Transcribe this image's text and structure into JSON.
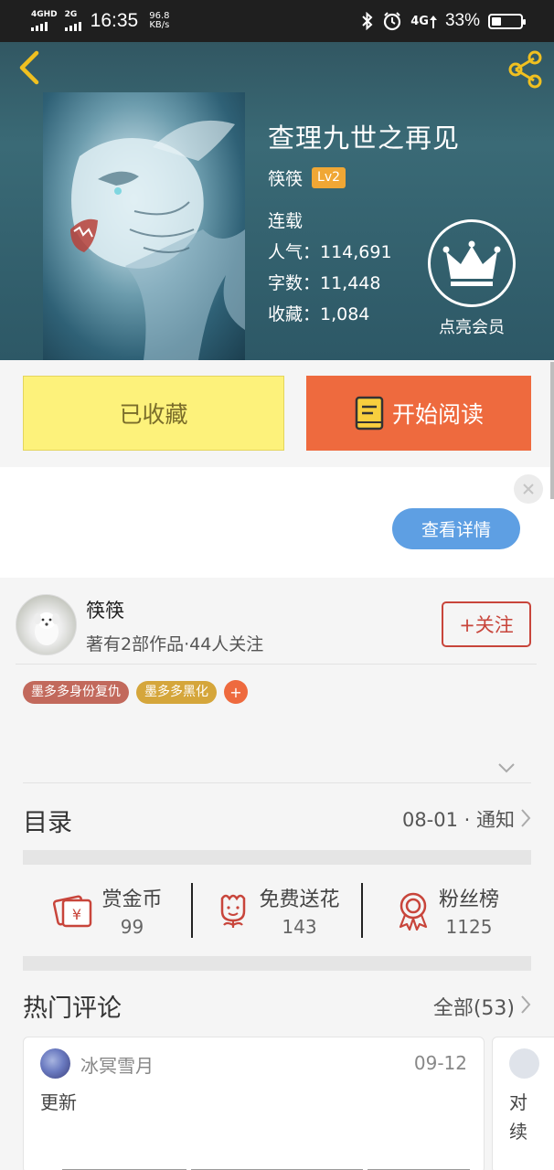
{
  "status_bar": {
    "sim1_label": "4GHD",
    "sim2_label": "2G",
    "time": "16:35",
    "speed_value": "96.8",
    "speed_unit": "KB/s",
    "network_label": "4G",
    "battery_percent": "33%",
    "battery_level": 0.33
  },
  "book": {
    "title": "查理九世之再见",
    "author": "筷筷",
    "author_level": "Lv2",
    "status": "连载",
    "popularity": "人气：114,691",
    "word_count": "字数：11,448",
    "favorites": "收藏：1,084",
    "vip_label": "点亮会员"
  },
  "actions": {
    "favorited_label": "已收藏",
    "read_label": "开始阅读"
  },
  "ad": {
    "detail_label": "查看详情"
  },
  "author_card": {
    "name": "筷筷",
    "info": "著有2部作品·44人关注",
    "follow_label": "+关注"
  },
  "tags": [
    "墨多多身份复仇",
    "墨多多黑化"
  ],
  "tag_add_label": "+",
  "toc": {
    "title": "目录",
    "update": "08-01 · 通知"
  },
  "stats": [
    {
      "label": "赏金币",
      "value": "99",
      "icon": "coin-envelope-icon"
    },
    {
      "label": "免费送花",
      "value": "143",
      "icon": "flower-icon"
    },
    {
      "label": "粉丝榜",
      "value": "1125",
      "icon": "medal-icon"
    }
  ],
  "hot_comments": {
    "title": "热门评论",
    "all_label": "全部(53)",
    "items": [
      {
        "user": "冰冥雪月",
        "date": "09-12",
        "text": "更新"
      },
      {
        "text": "对续"
      }
    ]
  },
  "colors": {
    "accent_orange": "#ee6a3e",
    "favorite_yellow": "#fdf27b",
    "follow_red": "#c8453b",
    "level_badge": "#f0a735",
    "detail_blue": "#5e9fe3",
    "icon_red": "#c8453b"
  }
}
